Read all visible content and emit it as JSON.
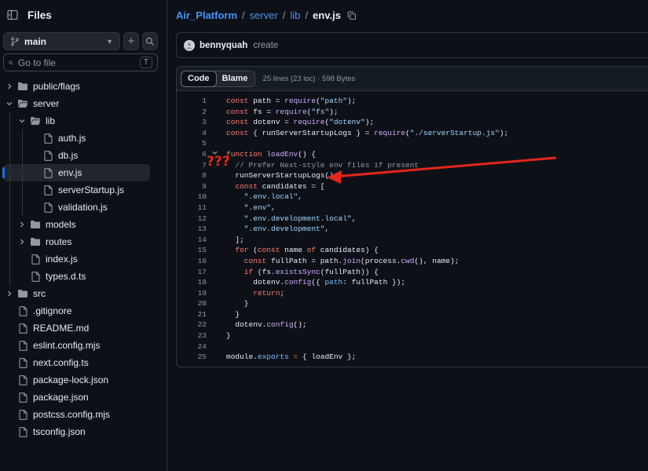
{
  "sidebar": {
    "title": "Files",
    "branch": "main",
    "goto_placeholder": "Go to file",
    "goto_shortcut": "T",
    "tree": [
      {
        "name": "public/flags",
        "type": "folder",
        "expanded": false,
        "depth": 0
      },
      {
        "name": "server",
        "type": "folder",
        "expanded": true,
        "depth": 0
      },
      {
        "name": "lib",
        "type": "folder",
        "expanded": true,
        "depth": 1
      },
      {
        "name": "auth.js",
        "type": "file",
        "depth": 2
      },
      {
        "name": "db.js",
        "type": "file",
        "depth": 2
      },
      {
        "name": "env.js",
        "type": "file",
        "depth": 2,
        "selected": true
      },
      {
        "name": "serverStartup.js",
        "type": "file",
        "depth": 2
      },
      {
        "name": "validation.js",
        "type": "file",
        "depth": 2
      },
      {
        "name": "models",
        "type": "folder",
        "expanded": false,
        "depth": 1
      },
      {
        "name": "routes",
        "type": "folder",
        "expanded": false,
        "depth": 1
      },
      {
        "name": "index.js",
        "type": "file",
        "depth": 1
      },
      {
        "name": "types.d.ts",
        "type": "file",
        "depth": 1
      },
      {
        "name": "src",
        "type": "folder",
        "expanded": false,
        "depth": 0
      },
      {
        "name": ".gitignore",
        "type": "file",
        "depth": 0
      },
      {
        "name": "README.md",
        "type": "file",
        "depth": 0
      },
      {
        "name": "eslint.config.mjs",
        "type": "file",
        "depth": 0
      },
      {
        "name": "next.config.ts",
        "type": "file",
        "depth": 0
      },
      {
        "name": "package-lock.json",
        "type": "file",
        "depth": 0
      },
      {
        "name": "package.json",
        "type": "file",
        "depth": 0
      },
      {
        "name": "postcss.config.mjs",
        "type": "file",
        "depth": 0
      },
      {
        "name": "tsconfig.json",
        "type": "file",
        "depth": 0
      }
    ]
  },
  "breadcrumb": {
    "repo": "Air_Platform",
    "parts": [
      "server",
      "lib"
    ],
    "current": "env.js",
    "separator": "/"
  },
  "commit": {
    "author": "bennyquah",
    "message": "create"
  },
  "code_view": {
    "tabs": [
      "Code",
      "Blame"
    ],
    "active_tab": "Code",
    "meta": "25 lines (23 loc) · 598 Bytes",
    "annotation": "???",
    "lines": [
      [
        [
          "k",
          "const "
        ],
        [
          "",
          "path = "
        ],
        [
          "f",
          "require"
        ],
        [
          "",
          "("
        ],
        [
          "s",
          "\"path\""
        ],
        [
          "",
          ");"
        ]
      ],
      [
        [
          "k",
          "const "
        ],
        [
          "",
          "fs = "
        ],
        [
          "f",
          "require"
        ],
        [
          "",
          "("
        ],
        [
          "s",
          "\"fs\""
        ],
        [
          "",
          ");"
        ]
      ],
      [
        [
          "k",
          "const "
        ],
        [
          "",
          "dotenv = "
        ],
        [
          "f",
          "require"
        ],
        [
          "",
          "("
        ],
        [
          "s",
          "\"dotenv\""
        ],
        [
          "",
          ");"
        ]
      ],
      [
        [
          "k",
          "const "
        ],
        [
          "",
          "{ runServerStartupLogs } = "
        ],
        [
          "f",
          "require"
        ],
        [
          "",
          "("
        ],
        [
          "s",
          "\"./serverStartup.js\""
        ],
        [
          "",
          ");"
        ]
      ],
      [],
      [
        [
          "k",
          "function "
        ],
        [
          "f",
          "loadEnv"
        ],
        [
          "",
          "() {"
        ]
      ],
      [
        [
          "c",
          "  // Prefer Next-style env files if present"
        ]
      ],
      [
        [
          "",
          "  runServerStartupLogs();"
        ]
      ],
      [
        [
          "k",
          "  const "
        ],
        [
          "",
          "candidates = ["
        ]
      ],
      [
        [
          "s",
          "    \".env.local\""
        ],
        [
          "",
          ","
        ]
      ],
      [
        [
          "s",
          "    \".env\""
        ],
        [
          "",
          ","
        ]
      ],
      [
        [
          "s",
          "    \".env.development.local\""
        ],
        [
          "",
          ","
        ]
      ],
      [
        [
          "s",
          "    \".env.development\""
        ],
        [
          "",
          ","
        ]
      ],
      [
        [
          "",
          "  ];"
        ]
      ],
      [
        [
          "k",
          "  for "
        ],
        [
          "",
          "("
        ],
        [
          "k",
          "const "
        ],
        [
          "",
          "name "
        ],
        [
          "k",
          "of "
        ],
        [
          "",
          "candidates) {"
        ]
      ],
      [
        [
          "k",
          "    const "
        ],
        [
          "",
          "fullPath = path."
        ],
        [
          "f",
          "join"
        ],
        [
          "",
          "(process."
        ],
        [
          "f",
          "cwd"
        ],
        [
          "",
          "(), name);"
        ]
      ],
      [
        [
          "k",
          "    if "
        ],
        [
          "",
          "(fs."
        ],
        [
          "f",
          "existsSync"
        ],
        [
          "",
          "(fullPath)) {"
        ]
      ],
      [
        [
          "",
          "      dotenv."
        ],
        [
          "f",
          "config"
        ],
        [
          "",
          "({ "
        ],
        [
          "p",
          "path"
        ],
        [
          "",
          ": fullPath });"
        ]
      ],
      [
        [
          "k",
          "      return"
        ],
        [
          "",
          ";"
        ]
      ],
      [
        [
          "",
          "    }"
        ]
      ],
      [
        [
          "",
          "  }"
        ]
      ],
      [
        [
          "",
          "  dotenv."
        ],
        [
          "f",
          "config"
        ],
        [
          "",
          "();"
        ]
      ],
      [
        [
          "",
          "}"
        ]
      ],
      [],
      [
        [
          "",
          "module."
        ],
        [
          "p",
          "exports"
        ],
        [
          "",
          ""
        ],
        [
          "k",
          " = "
        ],
        [
          "",
          "{ loadEnv };"
        ]
      ]
    ]
  },
  "colors": {
    "accent": "#4493f8",
    "annotation": "#e5261b"
  }
}
